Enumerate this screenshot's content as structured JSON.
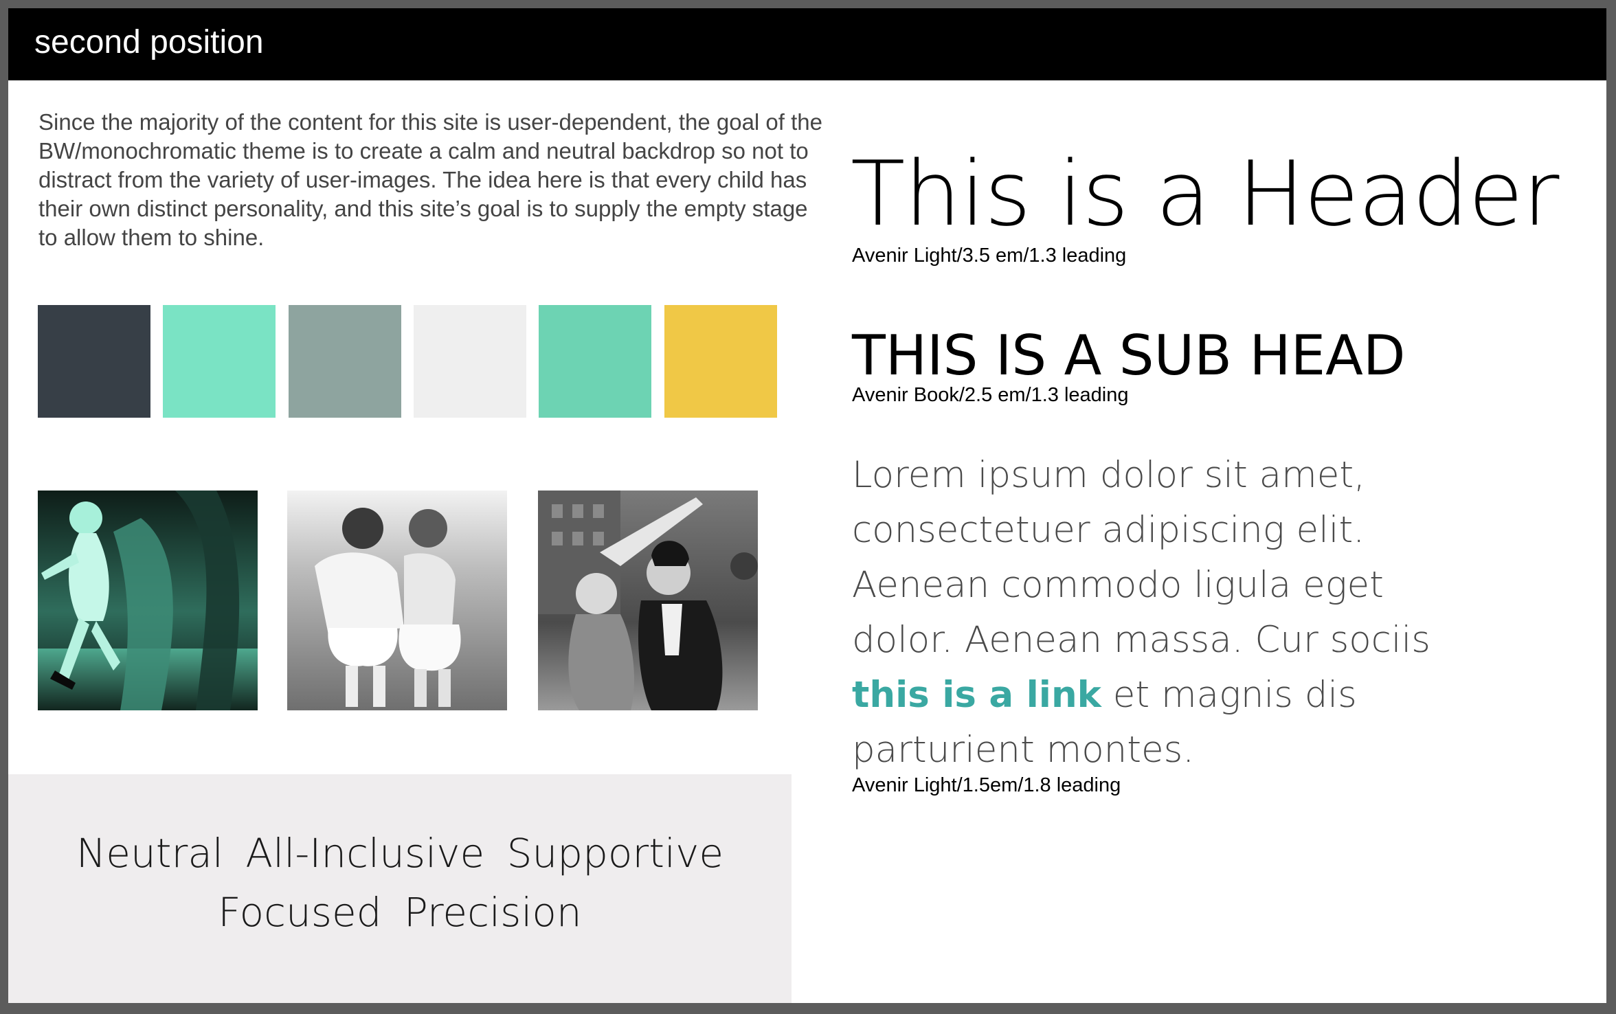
{
  "header": {
    "title": "second position"
  },
  "intro": {
    "text": "Since the majority of the content for this site is user-dependent, the goal of the BW/monochromatic theme is to create a calm and neutral backdrop so not to distract from the variety of user-images. The idea here is that every child has their own distinct personality, and this site’s goal is to supply the empty stage to allow them to shine."
  },
  "palette": {
    "swatches": [
      "#373f47",
      "#7ae3c4",
      "#8ea49f",
      "#efefef",
      "#6dd3b3",
      "#f0c846"
    ]
  },
  "photos": [
    {
      "icon": "dancing-child-photo",
      "tint": "#79e3c3"
    },
    {
      "icon": "two-ballerinas-photo",
      "tint": "#8a8a8a"
    },
    {
      "icon": "costumed-children-photo",
      "tint": "#6a6a6a"
    }
  ],
  "values": {
    "line1": [
      "Neutral",
      "All-Inclusive",
      "Supportive"
    ],
    "line2": [
      "Focused",
      "Precision"
    ]
  },
  "typography": {
    "header_sample": "This is a Header",
    "header_spec": "Avenir Light/3.5 em/1.3 leading",
    "subhead_sample": "THIS IS A SUB HEAD",
    "subhead_spec": "Avenir Book/2.5 em/1.3 leading",
    "body_lines": [
      "Lorem ipsum dolor sit amet,",
      "consectetuer adipiscing elit.",
      "Aenean commodo ligula eget",
      "dolor. Aenean massa. Cur sociis"
    ],
    "link_text": "this is a link",
    "body_after_link": " et magnis dis",
    "body_last_line": "parturient montes.",
    "body_spec": "Avenir Light/1.5em/1.8 leading",
    "link_color": "#3aa8a2"
  }
}
